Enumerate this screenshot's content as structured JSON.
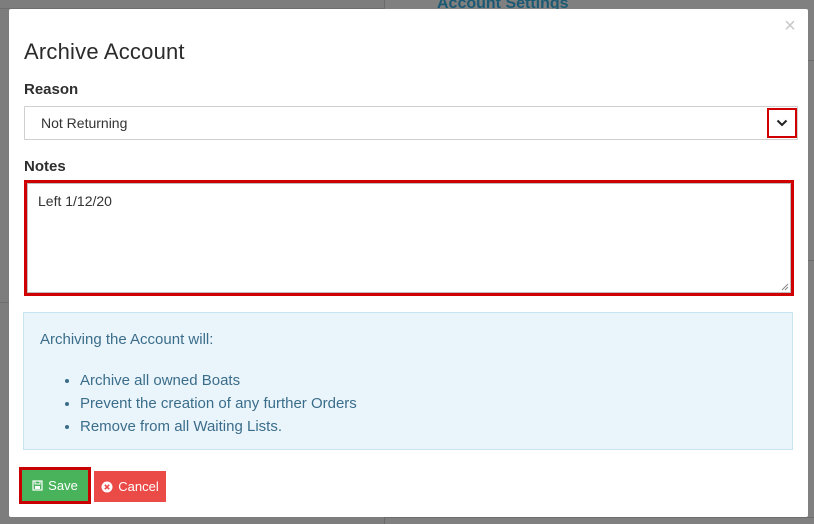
{
  "background": {
    "panel_title": "Account Settings"
  },
  "modal": {
    "title": "Archive Account",
    "close_label": "×",
    "reason": {
      "label": "Reason",
      "selected": "Not Returning"
    },
    "notes": {
      "label": "Notes",
      "value": "Left 1/12/20"
    },
    "info": {
      "heading": "Archiving the Account will:",
      "items": [
        "Archive all owned Boats",
        "Prevent the creation of any further Orders",
        "Remove from all Waiting Lists."
      ]
    },
    "buttons": {
      "save_label": "Save",
      "cancel_label": "Cancel"
    }
  },
  "colors": {
    "highlight": "#d00000",
    "save": "#49b35c",
    "cancel": "#ea4b47",
    "info_bg": "#eaf5fb",
    "info_text": "#3b6d8a"
  },
  "icons": {
    "select_arrow": "chevron-down-icon",
    "save": "save-icon",
    "cancel": "cancel-circle-icon"
  }
}
